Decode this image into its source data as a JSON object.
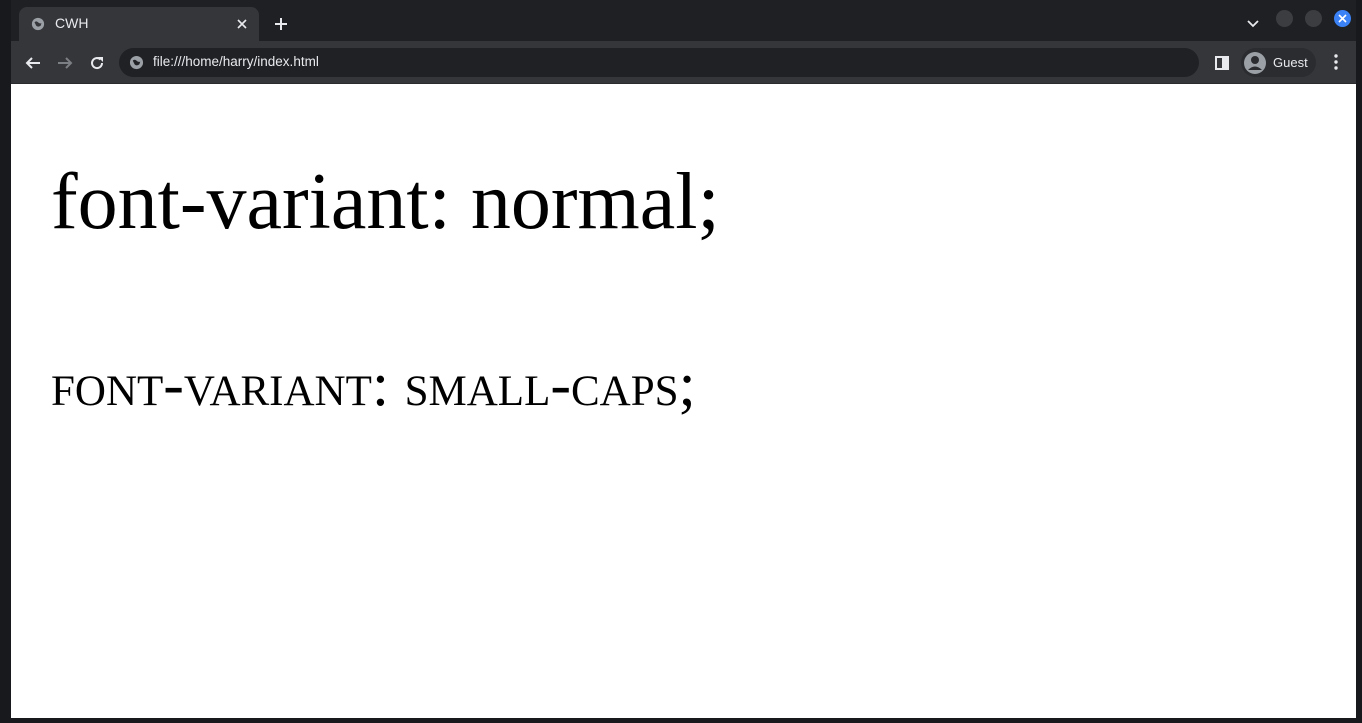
{
  "browser": {
    "tab": {
      "title": "CWH",
      "favicon": "globe-icon"
    },
    "address_bar": {
      "url": "file:///home/harry/index.html",
      "icon": "info-icon"
    },
    "profile": {
      "label": "Guest",
      "icon": "person-icon"
    },
    "accent_color": "#3b82f6"
  },
  "page": {
    "line1": "font-variant: normal;",
    "line2": "font-variant: small-caps;"
  }
}
